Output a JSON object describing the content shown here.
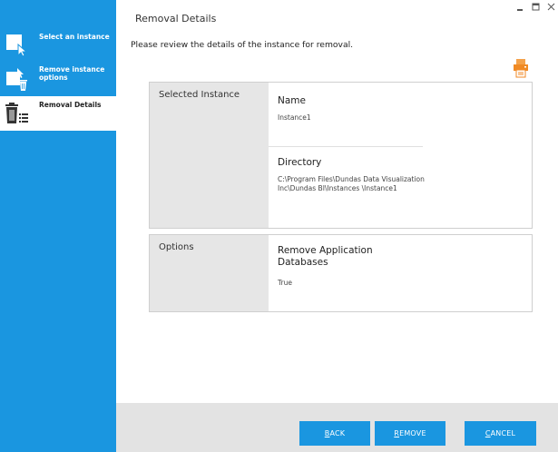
{
  "sidebar": {
    "steps": [
      {
        "label": "Select an instance",
        "active": false,
        "icon": "select-cursor-icon"
      },
      {
        "label": "Remove instance options",
        "active": false,
        "icon": "remove-options-icon"
      },
      {
        "label": "Removal Details",
        "active": true,
        "icon": "trash-list-icon"
      }
    ]
  },
  "header": {
    "title": "Removal Details",
    "subtitle": "Please review the details of the instance for removal."
  },
  "window_controls": [
    "minimize",
    "maximize",
    "close"
  ],
  "sections": [
    {
      "label": "Selected Instance",
      "fields": [
        {
          "title": "Name",
          "value": "Instance1"
        },
        {
          "title": "Directory",
          "value": "C:\\Program Files\\Dundas Data Visualization Inc\\Dundas BI\\Instances \\Instance1"
        }
      ]
    },
    {
      "label": "Options",
      "fields": [
        {
          "title": "Remove Application Databases",
          "value": "True"
        }
      ]
    }
  ],
  "buttons": {
    "back": {
      "first": "B",
      "rest": "ACK"
    },
    "remove": {
      "first": "R",
      "rest": "EMOVE"
    },
    "cancel": {
      "first": "C",
      "rest": "ANCEL"
    }
  },
  "colors": {
    "accent": "#1a96e0",
    "printer": "#f08a24"
  }
}
